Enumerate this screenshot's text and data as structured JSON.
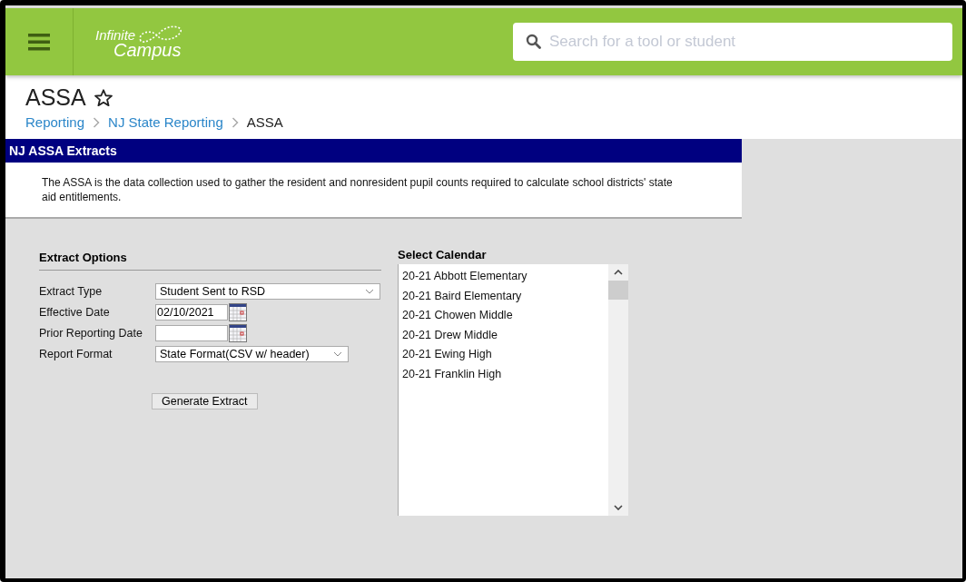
{
  "header": {
    "logo": {
      "line1": "Infinite",
      "line2": "Campus"
    },
    "search": {
      "placeholder": "Search for a tool or student"
    }
  },
  "page": {
    "title": "ASSA",
    "favorite": false,
    "breadcrumbs": [
      {
        "label": "Reporting",
        "link": true
      },
      {
        "label": "NJ State Reporting",
        "link": true
      },
      {
        "label": "ASSA",
        "link": false
      }
    ]
  },
  "panel": {
    "title": "NJ ASSA Extracts",
    "description": "The ASSA is the data collection used to gather the resident and nonresident pupil counts required to calculate school districts' state aid entitlements."
  },
  "extract_options": {
    "heading": "Extract Options",
    "fields": [
      {
        "label": "Extract Type",
        "kind": "select",
        "value": "Student Sent to RSD"
      },
      {
        "label": "Effective Date",
        "kind": "date",
        "value": "02/10/2021"
      },
      {
        "label": "Prior Reporting Date",
        "kind": "date"
      },
      {
        "label": "Report Format",
        "kind": "select",
        "value": "State Format(CSV w/ header)"
      }
    ],
    "button": "Generate Extract"
  },
  "calendar": {
    "heading": "Select Calendar",
    "items": [
      {
        "label": "20-21 Abbott Elementary",
        "selected": false
      },
      {
        "label": "20-21 Baird Elementary",
        "selected": false
      },
      {
        "label": "20-21 Chowen Middle",
        "selected": false
      },
      {
        "label": "20-21 Drew Middle",
        "selected": false
      },
      {
        "label": "20-21 Ewing High",
        "selected": false
      },
      {
        "label": "20-21 Franklin High",
        "selected": false
      }
    ]
  }
}
